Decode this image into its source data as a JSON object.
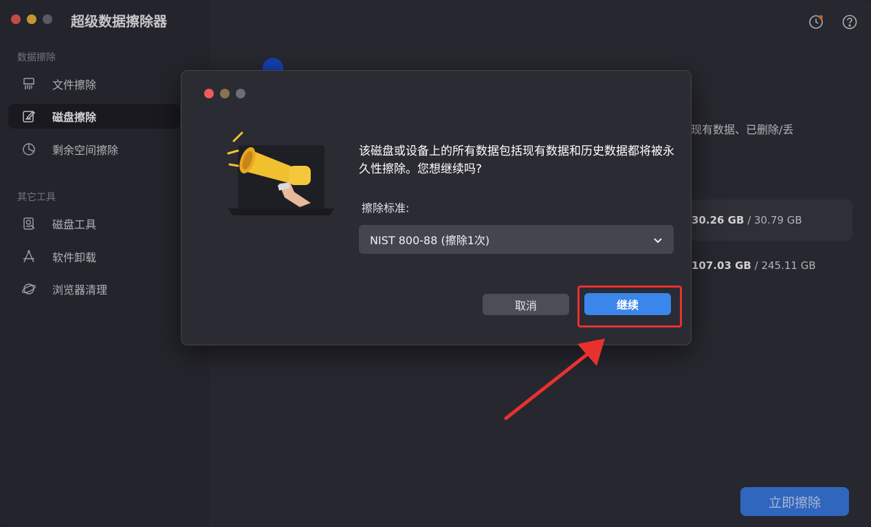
{
  "app": {
    "title": "超级数据擦除器",
    "traffic_colors": [
      "#ee5c55",
      "#f1b83b",
      "#6d6d75"
    ]
  },
  "sidebar": {
    "section1_label": "数据擦除",
    "section2_label": "其它工具",
    "items": [
      {
        "label": "文件擦除",
        "icon": "shredder-icon",
        "active": false
      },
      {
        "label": "磁盘擦除",
        "icon": "disk-edit-icon",
        "active": true
      },
      {
        "label": "剩余空间擦除",
        "icon": "pie-chart-icon",
        "active": false
      },
      {
        "label": "磁盘工具",
        "icon": "disk-tool-icon",
        "active": false
      },
      {
        "label": "软件卸载",
        "icon": "app-uninstall-icon",
        "active": false
      },
      {
        "label": "浏览器清理",
        "icon": "browser-clean-icon",
        "active": false
      }
    ]
  },
  "header": {
    "history_icon": "history-clock-icon",
    "help_icon": "help-icon"
  },
  "main": {
    "description_fragment": "现有数据、已删除/丢",
    "disks": [
      {
        "used": "30.26 GB",
        "total": " / 30.79 GB",
        "selected": true
      },
      {
        "used": "107.03 GB",
        "total": " / 245.11 GB",
        "selected": false
      }
    ],
    "erase_now_label": "立即擦除"
  },
  "dialog": {
    "traffic_colors": [
      "#ee5c55",
      "#8a7350",
      "#6d6d75"
    ],
    "art_icon": "megaphone-icon",
    "message": "该磁盘或设备上的所有数据包括现有数据和历史数据都将被永久性擦除。您想继续吗?",
    "standard_label": "擦除标准:",
    "standard_value": "NIST 800-88 (擦除1次)",
    "cancel_label": "取消",
    "continue_label": "继续"
  },
  "annotation": {
    "highlight_color": "#e8312f"
  }
}
